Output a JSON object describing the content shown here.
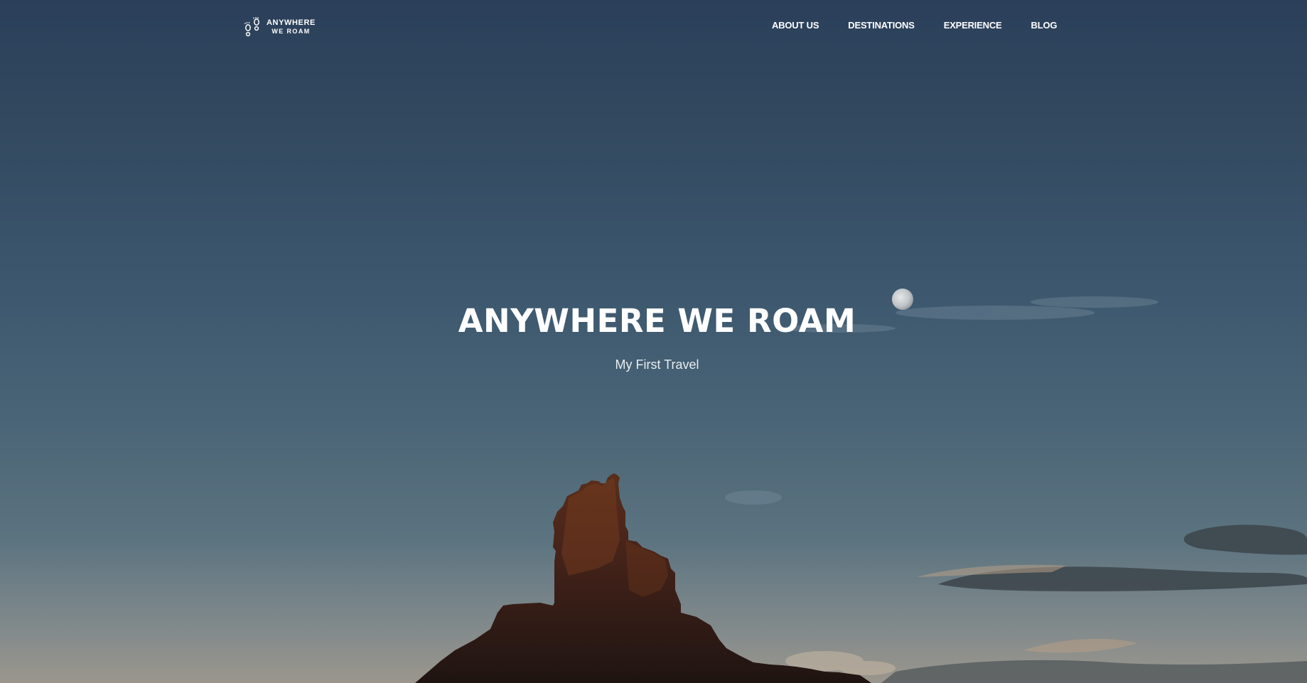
{
  "brand": {
    "line1": "ANYWHERE",
    "line2": "WE ROAM",
    "logo_icon": "footprints-icon"
  },
  "nav": {
    "items": [
      {
        "label": "ABOUT US"
      },
      {
        "label": "DESTINATIONS"
      },
      {
        "label": "EXPERIENCE"
      },
      {
        "label": "BLOG"
      }
    ]
  },
  "hero": {
    "title": "ANYWHERE WE ROAM",
    "subtitle": "My First Travel",
    "background": "desert-butte-night-sky-with-moon"
  },
  "colors": {
    "sky_top": "#2b3f5a",
    "sky_bottom": "#8a8f8e",
    "text": "#ffffff"
  }
}
